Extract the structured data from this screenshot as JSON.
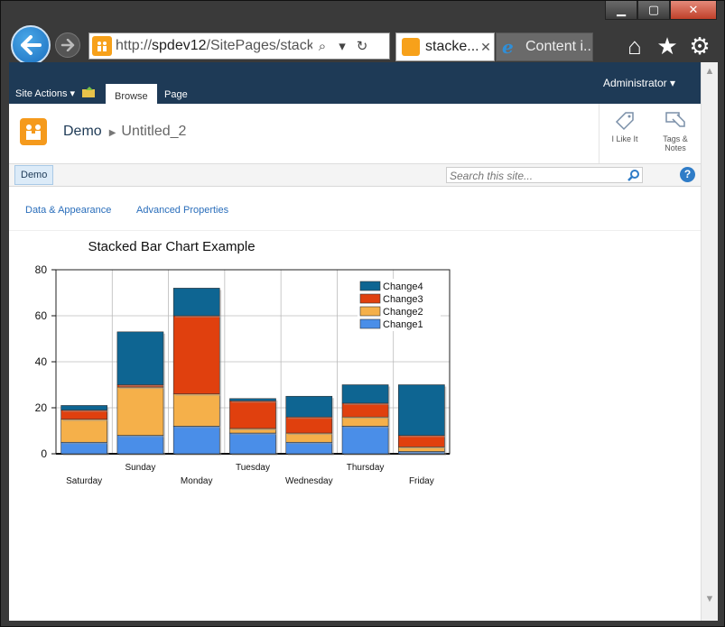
{
  "browser": {
    "address": {
      "prefix": "http://",
      "host": "spdev12",
      "path": "/SitePages/stackec"
    },
    "tabs": [
      {
        "label": "stacke...",
        "active": true
      },
      {
        "label": "Content i...",
        "active": false
      }
    ]
  },
  "ribbon": {
    "site_actions": "Site Actions",
    "tabs": [
      "Browse",
      "Page"
    ],
    "user": "Administrator"
  },
  "breadcrumb": {
    "site": "Demo",
    "page": "Untitled_2"
  },
  "social": {
    "like": "I Like It",
    "tags": "Tags &",
    "notes": "Notes"
  },
  "quicklaunch": {
    "item": "Demo"
  },
  "search": {
    "placeholder": "Search this site..."
  },
  "toolbar": {
    "data_appearance": "Data & Appearance",
    "advanced": "Advanced Properties"
  },
  "chart_data": {
    "type": "bar",
    "stacked": true,
    "title": "Stacked Bar Chart Example",
    "xlabel": "",
    "ylabel": "",
    "ylim": [
      0,
      80
    ],
    "yticks": [
      0,
      20,
      40,
      60,
      80
    ],
    "grid": true,
    "legend_position": "top-right",
    "categories": [
      "Saturday",
      "Sunday",
      "Monday",
      "Tuesday",
      "Wednesday",
      "Thursday",
      "Friday"
    ],
    "series": [
      {
        "name": "Change1",
        "color": "#4a8ee8",
        "values": [
          5,
          8,
          12,
          9,
          5,
          12,
          1
        ]
      },
      {
        "name": "Change2",
        "color": "#f5b04a",
        "values": [
          10,
          21,
          14,
          2,
          4,
          4,
          2
        ]
      },
      {
        "name": "Change3",
        "color": "#e0400e",
        "values": [
          4,
          1,
          34,
          12,
          7,
          6,
          5
        ]
      },
      {
        "name": "Change4",
        "color": "#0e6592",
        "values": [
          2,
          23,
          12,
          1,
          9,
          8,
          22
        ]
      }
    ]
  }
}
